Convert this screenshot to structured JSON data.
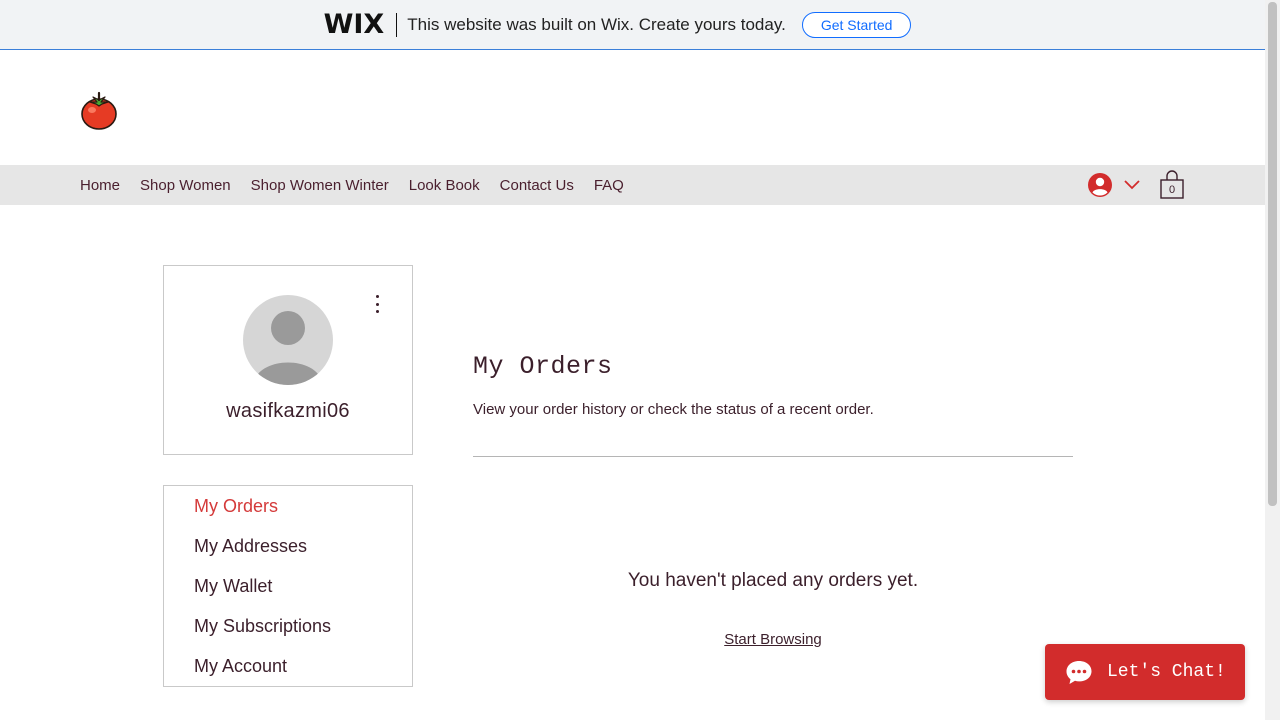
{
  "banner": {
    "logo": "WIX",
    "text": "This website was built on Wix. Create yours today.",
    "button": "Get Started"
  },
  "logo": {
    "icon": "tomato-icon"
  },
  "nav": {
    "links": [
      "Home",
      "Shop Women",
      "Shop Women Winter",
      "Look Book",
      "Contact Us",
      "FAQ"
    ],
    "cart_count": "0"
  },
  "profile": {
    "username": "wasifkazmi06"
  },
  "menu": {
    "items": [
      "My Orders",
      "My Addresses",
      "My Wallet",
      "My Subscriptions",
      "My Account"
    ],
    "active": "My Orders"
  },
  "orders": {
    "title": "My Orders",
    "subtitle": "View your order history or check the status of a recent order.",
    "empty_message": "You haven't placed any orders yet.",
    "browse_link": "Start Browsing"
  },
  "chat": {
    "label": "Let's Chat!"
  },
  "colors": {
    "accent": "#d43a3a",
    "text": "#3b1f2b",
    "nav_bg": "#e6e6e6",
    "chat_bg": "#d22c2c",
    "wix_blue": "#116dff"
  }
}
